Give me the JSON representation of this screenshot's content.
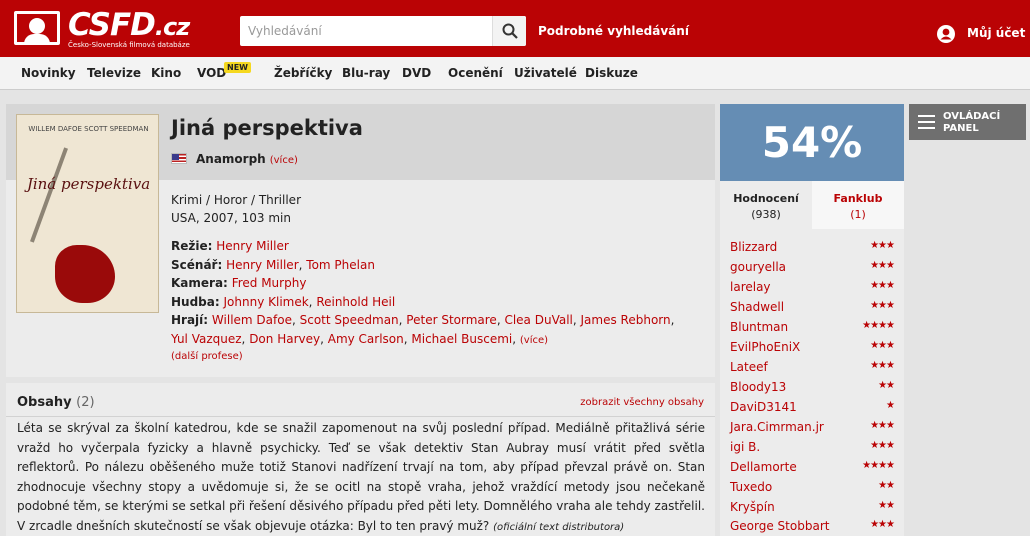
{
  "header": {
    "logo_text": "CSFD",
    "logo_domain": ".cz",
    "logo_subtitle": "Česko-Slovenská filmová databáze",
    "search_placeholder": "Vyhledávání",
    "advanced_search": "Podrobné vyhledávání",
    "account": "Můj účet",
    "brand_color": "#ba0305"
  },
  "nav": {
    "items": [
      "Novinky",
      "Televize",
      "Kino",
      "VOD",
      "Žebříčky",
      "Blu-ray",
      "DVD",
      "Ocenění",
      "Uživatelé",
      "Diskuze"
    ],
    "vod_badge": "NEW"
  },
  "film": {
    "poster_actors": "WILLEM DAFOE   SCOTT SPEEDMAN",
    "poster_title": "Jiná perspektiva",
    "title": "Jiná perspektiva",
    "original_title": "Anamorph",
    "original_more": "(více)",
    "genre": "Krimi / Horor / Thriller",
    "origin": "USA, 2007, 103 min",
    "directing_label": "Režie:",
    "directing": [
      "Henry Miller"
    ],
    "screenplay_label": "Scénář:",
    "screenplay": [
      "Henry Miller",
      "Tom Phelan"
    ],
    "camera_label": "Kamera:",
    "camera": [
      "Fred Murphy"
    ],
    "music_label": "Hudba:",
    "music": [
      "Johnny Klimek",
      "Reinhold Heil"
    ],
    "cast_label": "Hrají:",
    "cast": [
      "Willem Dafoe",
      "Scott Speedman",
      "Peter Stormare",
      "Clea DuVall",
      "James Rebhorn",
      "Yul Vazquez",
      "Don Harvey",
      "Amy Carlson",
      "Michael Buscemi"
    ],
    "cast_more": "(více)",
    "more_professions": "(další profese)"
  },
  "plot": {
    "title": "Obsahy",
    "count": "(2)",
    "show_all": "zobrazit všechny obsahy",
    "text": "Léta se skrýval za školní katedrou, kde se snažil zapomenout na svůj poslední případ. Mediálně přitažlivá série vražd ho vyčerpala fyzicky a hlavně psychicky. Teď se však detektiv Stan Aubray musí vrátit před světla reflektorů. Po nálezu oběšeného muže totiž Stanovi nadřízení trvají na tom, aby případ převzal právě on. Stan zhodnocuje všechny stopy a uvědomuje si, že se ocitl na stopě vraha, jehož vraždící metody jsou nečekaně podobné těm, se kterými se setkal při řešení děsivého případu před pěti lety. Domnělého vraha ale tehdy zastřelil. V zrcadle dnešních skutečností se však objevuje otázka: Byl to ten pravý muž?",
    "source": "(oficiální text distributora)"
  },
  "rating": {
    "value": "54%",
    "color": "#658db4",
    "tab_ratings": "Hodnocení",
    "tab_ratings_count": "(938)",
    "tab_fanclub": "Fanklub",
    "tab_fanclub_count": "(1)"
  },
  "user_ratings": [
    {
      "name": "Blizzard",
      "stars": "★★★"
    },
    {
      "name": "gouryella",
      "stars": "★★★"
    },
    {
      "name": "larelay",
      "stars": "★★★"
    },
    {
      "name": "Shadwell",
      "stars": "★★★"
    },
    {
      "name": "Bluntman",
      "stars": "★★★★"
    },
    {
      "name": "EvilPhoEniX",
      "stars": "★★★"
    },
    {
      "name": "Lateef",
      "stars": "★★★"
    },
    {
      "name": "Bloody13",
      "stars": "★★"
    },
    {
      "name": "DaviD3141",
      "stars": "★"
    },
    {
      "name": "Jara.Cimrman.jr",
      "stars": "★★★"
    },
    {
      "name": "igi B.",
      "stars": "★★★"
    },
    {
      "name": "Dellamorte",
      "stars": "★★★★"
    },
    {
      "name": "Tuxedo",
      "stars": "★★"
    },
    {
      "name": "Kryšpín",
      "stars": "★★"
    },
    {
      "name": "George Stobbart",
      "stars": "★★★"
    }
  ],
  "control_panel": {
    "line1": "OVLÁDACÍ",
    "line2": "PANEL"
  }
}
